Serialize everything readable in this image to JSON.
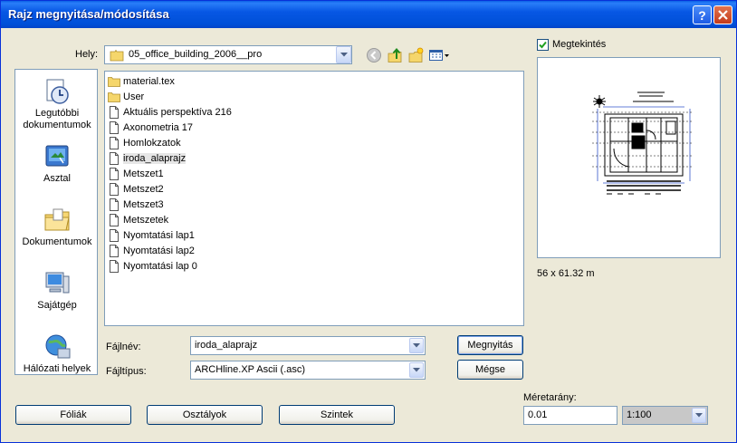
{
  "window": {
    "title": "Rajz megnyitása/módosítása"
  },
  "location": {
    "label": "Hely:",
    "value": "05_office_building_2006__pro"
  },
  "places": [
    {
      "label": "Legutóbbi dokumentumok"
    },
    {
      "label": "Asztal"
    },
    {
      "label": "Dokumentumok"
    },
    {
      "label": "Sajátgép"
    },
    {
      "label": "Hálózati helyek"
    }
  ],
  "files": [
    {
      "name": "material.tex",
      "type": "folder"
    },
    {
      "name": "User",
      "type": "folder"
    },
    {
      "name": "Aktuális perspektíva 216",
      "type": "file"
    },
    {
      "name": "Axonometria 17",
      "type": "file"
    },
    {
      "name": "Homlokzatok",
      "type": "file"
    },
    {
      "name": "iroda_alaprajz",
      "type": "file",
      "selected": true
    },
    {
      "name": "Metszet1",
      "type": "file"
    },
    {
      "name": "Metszet2",
      "type": "file"
    },
    {
      "name": "Metszet3",
      "type": "file"
    },
    {
      "name": "Metszetek",
      "type": "file"
    },
    {
      "name": "Nyomtatási lap1",
      "type": "file"
    },
    {
      "name": "Nyomtatási lap2",
      "type": "file"
    },
    {
      "name": "Nyomtatási lap 0",
      "type": "file"
    }
  ],
  "filename": {
    "label": "Fájlnév:",
    "value": "iroda_alaprajz"
  },
  "filetype": {
    "label": "Fájltípus:",
    "value": "ARCHline.XP Ascii (.asc)"
  },
  "buttons": {
    "open": "Megnyitás",
    "cancel": "Mégse",
    "layers": "Fóliák",
    "classes": "Osztályok",
    "levels": "Szintek"
  },
  "preview": {
    "checkbox_label": "Megtekintés",
    "checked": true,
    "dimensions": "56 x 61.32 m"
  },
  "scale": {
    "label": "Méretarány:",
    "value": "0.01",
    "ratio": "1:100"
  },
  "colors": {
    "titlebar": "#0054e3",
    "face": "#ece9d8",
    "border": "#7f9db9"
  }
}
